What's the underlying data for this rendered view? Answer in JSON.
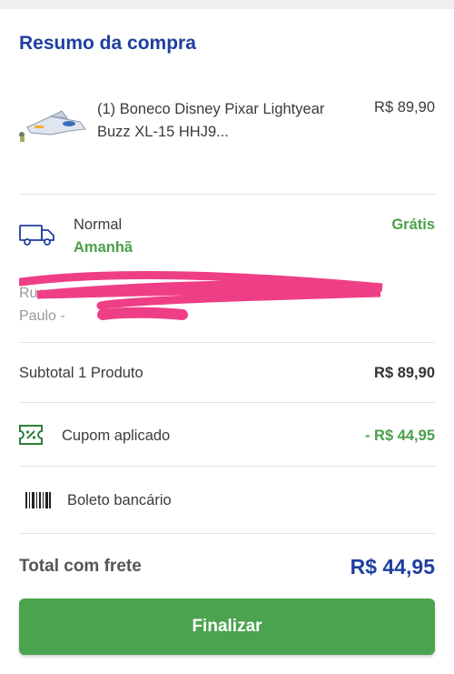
{
  "colors": {
    "title": "#1f3f9f",
    "green": "#4aa04a",
    "button": "#4ca34f",
    "total": "#1f3f9f",
    "redaction": "#ee3f86"
  },
  "summary": {
    "title": "Resumo da compra"
  },
  "product": {
    "image_icon": "toy-spaceship-image",
    "name": "(1) Boneco Disney Pixar Lightyear Buzz XL-15 HHJ9...",
    "price": "R$ 89,90"
  },
  "shipping": {
    "icon": "truck-icon",
    "method": "Normal",
    "eta": "Amanhã",
    "price": "Grátis",
    "address_line1": "Rua",
    "address_line2": "Paulo -"
  },
  "subtotal": {
    "label": "Subtotal 1 Produto",
    "value": "R$ 89,90"
  },
  "coupon": {
    "icon": "coupon-icon",
    "label": "Cupom aplicado",
    "value": "- R$ 44,95"
  },
  "payment": {
    "icon": "barcode-icon",
    "label": "Boleto bancário"
  },
  "total": {
    "label": "Total com frete",
    "value": "R$ 44,95"
  },
  "actions": {
    "finalize_label": "Finalizar"
  }
}
